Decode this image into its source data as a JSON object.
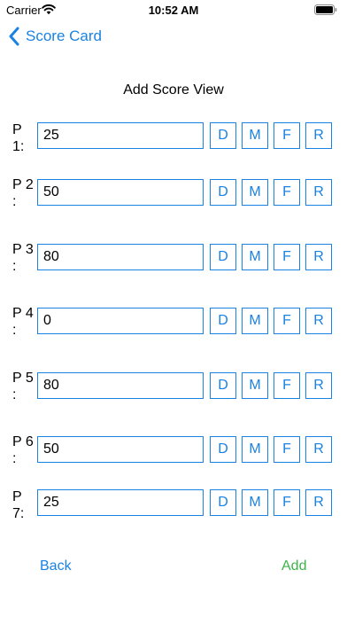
{
  "status_bar": {
    "carrier": "Carrier",
    "time": "10:52 AM",
    "wifi_icon": "wifi-icon",
    "battery_icon": "battery-icon"
  },
  "nav": {
    "back_label": "Score Card",
    "back_icon": "chevron-left-icon"
  },
  "title": "Add Score View",
  "rows": [
    {
      "label": "P 1:",
      "value": "25"
    },
    {
      "label": "P 2 :",
      "value": "50"
    },
    {
      "label": "P 3 :",
      "value": "80"
    },
    {
      "label": "P 4 :",
      "value": "0"
    },
    {
      "label": "P 5 :",
      "value": "80"
    },
    {
      "label": "P 6 :",
      "value": "50"
    },
    {
      "label": "P 7:",
      "value": "25"
    }
  ],
  "option_buttons": [
    "D",
    "M",
    "F",
    "R"
  ],
  "footer": {
    "back_label": "Back",
    "add_label": "Add"
  },
  "colors": {
    "accent": "#1a82e2",
    "add": "#3cb44a"
  }
}
